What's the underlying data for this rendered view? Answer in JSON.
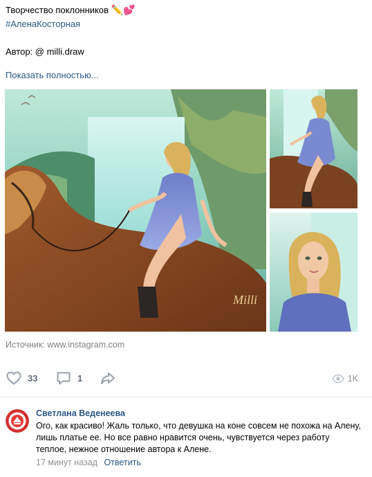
{
  "post": {
    "title": "Творчество поклонников",
    "title_emoji": "✏️💕",
    "hashtag": "#АленаКосторная",
    "author_line": "Автор: @ milli.draw",
    "show_more": "Показать полностью...",
    "source_label": "Источник:",
    "source_value": "www.instagram.com",
    "signature": "Milli"
  },
  "actions": {
    "likes": "33",
    "comments": "1",
    "views": "1K"
  },
  "comment": {
    "author": "Светлана Веденеева",
    "text": "Ого, как красиво! Жаль только, что девушка на коне совсем не похожа на Алену, лишь платье ее. Но все равно нравится очень, чувствуется через работу теплое, нежное отношение автора к Алене.",
    "time": "17 минут назад",
    "reply_label": "Ответить"
  },
  "colors": {
    "link": "#2a5885",
    "meta": "#939393",
    "icon": "#99a2ad"
  }
}
